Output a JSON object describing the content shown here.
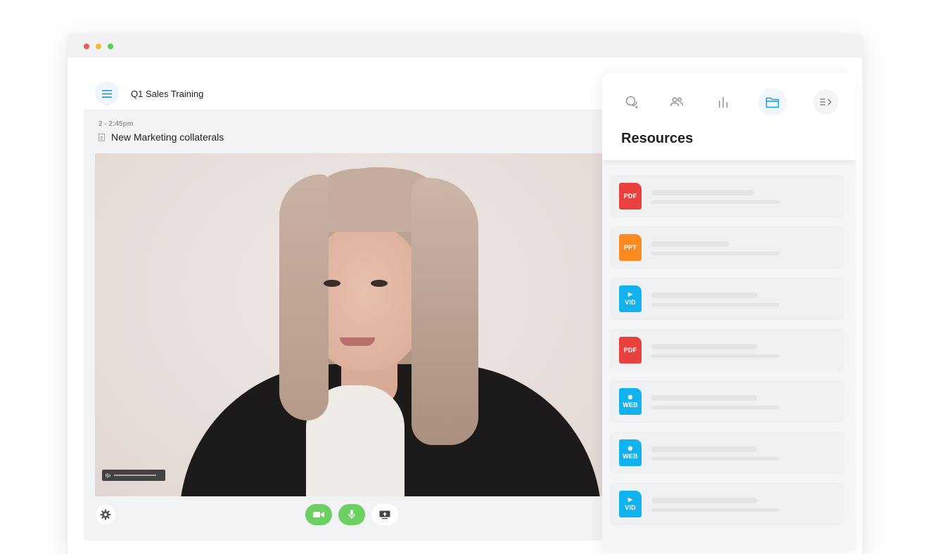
{
  "app": {
    "title": "Q1 Sales Training",
    "session": {
      "time": "2 - 2:45pm",
      "name": "New Marketing collaterals"
    }
  },
  "video_controls": {
    "settings_icon": "gear-icon",
    "camera_icon": "video-camera-icon",
    "mic_icon": "microphone-icon",
    "share_icon": "screen-share-icon",
    "active_color": "#6ccf62"
  },
  "panel": {
    "title": "Resources",
    "tabs": [
      {
        "name": "chat",
        "icon": "chat-icon"
      },
      {
        "name": "people",
        "icon": "people-icon"
      },
      {
        "name": "polls",
        "icon": "bar-chart-icon"
      },
      {
        "name": "resources",
        "icon": "folder-icon",
        "active": true
      },
      {
        "name": "collapse",
        "icon": "collapse-panel-icon"
      }
    ],
    "files": [
      {
        "type": "PDF",
        "color": "#e8413e",
        "glyph": ""
      },
      {
        "type": "PPT",
        "color": "#fb8a1f",
        "glyph": ""
      },
      {
        "type": "VID",
        "color": "#12b2ef",
        "glyph": "▶"
      },
      {
        "type": "PDF",
        "color": "#e8413e",
        "glyph": ""
      },
      {
        "type": "WEB",
        "color": "#12b2ef",
        "glyph": "◉"
      },
      {
        "type": "WEB",
        "color": "#12b2ef",
        "glyph": "◉"
      },
      {
        "type": "VID",
        "color": "#12b2ef",
        "glyph": "▶"
      }
    ]
  }
}
